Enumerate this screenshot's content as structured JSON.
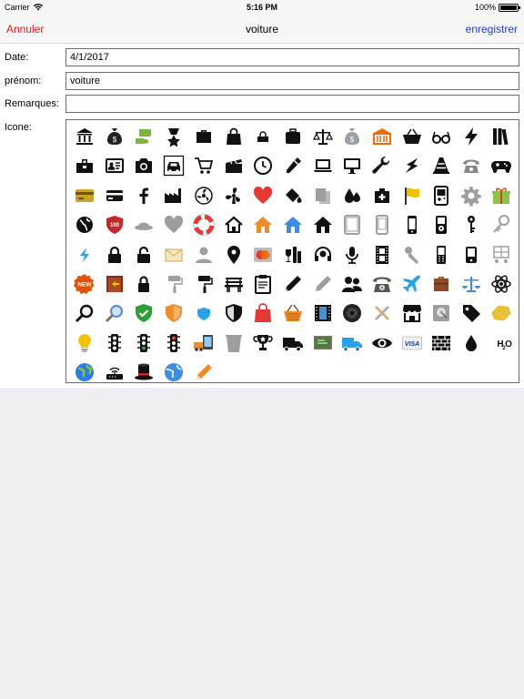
{
  "status_bar": {
    "carrier": "Carrier",
    "time": "5:16 PM",
    "battery": "100%",
    "battery_level": 1.0
  },
  "nav": {
    "cancel_label": "Annuler",
    "title": "voiture",
    "save_label": "enregistrer"
  },
  "form": {
    "date_label": "Date:",
    "date_value": "4/1/2017",
    "firstname_label": "prénom:",
    "firstname_value": "voiture",
    "remarks_label": "Remarques:",
    "remarks_value": "",
    "icon_label": "Icone:"
  },
  "colors": {
    "accent_red": "#e31b1b",
    "accent_blue": "#1d3fd6"
  },
  "icons": [
    {
      "name": "bank",
      "color": "#111111"
    },
    {
      "name": "money-bag",
      "color": "#222222"
    },
    {
      "name": "money-hand",
      "color": "#7cb342"
    },
    {
      "name": "medal",
      "color": "#111111"
    },
    {
      "name": "briefcase",
      "color": "#111111"
    },
    {
      "name": "shopping-bag",
      "color": "#111111"
    },
    {
      "name": "small-bag",
      "color": "#111111"
    },
    {
      "name": "suitcase",
      "color": "#111111"
    },
    {
      "name": "scales",
      "color": "#111111"
    },
    {
      "name": "money-sack",
      "color": "#9aa0a6"
    },
    {
      "name": "museum",
      "color": "#ef6c00"
    },
    {
      "name": "basket",
      "color": "#111111"
    },
    {
      "name": "glasses",
      "color": "#111111"
    },
    {
      "name": "lightning",
      "color": "#111111"
    },
    {
      "name": "books",
      "color": "#111111"
    },
    {
      "name": "toolbox",
      "color": "#111111"
    },
    {
      "name": "id-card",
      "color": "#111111"
    },
    {
      "name": "camera",
      "color": "#111111"
    },
    {
      "name": "car",
      "color": "#111111"
    },
    {
      "name": "cart",
      "color": "#111111"
    },
    {
      "name": "clapperboard",
      "color": "#111111"
    },
    {
      "name": "clock",
      "color": "#111111"
    },
    {
      "name": "pipette",
      "color": "#111111"
    },
    {
      "name": "laptop",
      "color": "#111111"
    },
    {
      "name": "computer",
      "color": "#111111"
    },
    {
      "name": "wrench",
      "color": "#111111"
    },
    {
      "name": "bolt",
      "color": "#111111"
    },
    {
      "name": "cone",
      "color": "#111111"
    },
    {
      "name": "telephone",
      "color": "#888888"
    },
    {
      "name": "gamepad",
      "color": "#111111"
    },
    {
      "name": "credit-card-gold",
      "color": "#c9a227"
    },
    {
      "name": "credit-card",
      "color": "#111111"
    },
    {
      "name": "facebook",
      "color": "#111111"
    },
    {
      "name": "factory",
      "color": "#111111"
    },
    {
      "name": "fan",
      "color": "#111111"
    },
    {
      "name": "fan-blades",
      "color": "#111111"
    },
    {
      "name": "heart",
      "color": "#e53935"
    },
    {
      "name": "paint-bucket",
      "color": "#111111"
    },
    {
      "name": "film-slides",
      "color": "#9e9e9e"
    },
    {
      "name": "drops",
      "color": "#111111"
    },
    {
      "name": "first-aid",
      "color": "#111111"
    },
    {
      "name": "flag",
      "color": "#f2c200"
    },
    {
      "name": "gameboy",
      "color": "#111111"
    },
    {
      "name": "gear",
      "color": "#9e9e9e"
    },
    {
      "name": "gift",
      "color": "#8bc34a"
    },
    {
      "name": "globe",
      "color": "#111111"
    },
    {
      "name": "shield-100",
      "color": "#c62828"
    },
    {
      "name": "hat",
      "color": "#9e9e9e"
    },
    {
      "name": "heart-gray",
      "color": "#9e9e9e"
    },
    {
      "name": "lifebuoy",
      "color": "#e53935"
    },
    {
      "name": "house-outline",
      "color": "#111111"
    },
    {
      "name": "house-orange",
      "color": "#ef8c2a"
    },
    {
      "name": "house-blue",
      "color": "#3f8ce0"
    },
    {
      "name": "house-black",
      "color": "#111111"
    },
    {
      "name": "tablet",
      "color": "#9e9e9e"
    },
    {
      "name": "phone-outline",
      "color": "#9e9e9e"
    },
    {
      "name": "phone",
      "color": "#111111"
    },
    {
      "name": "ipod",
      "color": "#111111"
    },
    {
      "name": "key",
      "color": "#111111"
    },
    {
      "name": "key-gray",
      "color": "#9e9e9e"
    },
    {
      "name": "lightning-blue",
      "color": "#29a3e8"
    },
    {
      "name": "lock",
      "color": "#111111"
    },
    {
      "name": "unlock",
      "color": "#111111"
    },
    {
      "name": "envelope",
      "color": "#d9b36a"
    },
    {
      "name": "person",
      "color": "#9e9e9e"
    },
    {
      "name": "map-pin",
      "color": "#111111"
    },
    {
      "name": "mastercard",
      "color": "#ef6c00"
    },
    {
      "name": "wine",
      "color": "#111111"
    },
    {
      "name": "headset",
      "color": "#111111"
    },
    {
      "name": "microphone",
      "color": "#111111"
    },
    {
      "name": "film",
      "color": "#111111"
    },
    {
      "name": "mic-gray",
      "color": "#9e9e9e"
    },
    {
      "name": "mobile",
      "color": "#111111"
    },
    {
      "name": "mobile-alt",
      "color": "#111111"
    },
    {
      "name": "cart-gray",
      "color": "#9e9e9e"
    },
    {
      "name": "new-badge",
      "color": "#e65100"
    },
    {
      "name": "door",
      "color": "#8d2a0e"
    },
    {
      "name": "padlock",
      "color": "#111111"
    },
    {
      "name": "paint-roller-gray",
      "color": "#9e9e9e"
    },
    {
      "name": "paint-roller",
      "color": "#111111"
    },
    {
      "name": "bench",
      "color": "#111111"
    },
    {
      "name": "clipboard",
      "color": "#111111"
    },
    {
      "name": "pen",
      "color": "#111111"
    },
    {
      "name": "pencil-gray",
      "color": "#9e9e9e"
    },
    {
      "name": "people",
      "color": "#111111"
    },
    {
      "name": "rotary-phone",
      "color": "#555555"
    },
    {
      "name": "plane",
      "color": "#29a3e8"
    },
    {
      "name": "briefcase-brown",
      "color": "#8d4a24"
    },
    {
      "name": "scales-blue",
      "color": "#3f8ce0"
    },
    {
      "name": "atom",
      "color": "#111111"
    },
    {
      "name": "magnifier",
      "color": "#111111"
    },
    {
      "name": "magnifier-blue",
      "color": "#5c8fd6"
    },
    {
      "name": "shield-check",
      "color": "#2e9e3a"
    },
    {
      "name": "shield-orange",
      "color": "#ef8c2a"
    },
    {
      "name": "shield-blue",
      "color": "#29a3e8"
    },
    {
      "name": "shield-black",
      "color": "#111111"
    },
    {
      "name": "bag-red",
      "color": "#e53935"
    },
    {
      "name": "basket-orange",
      "color": "#ef8c2a"
    },
    {
      "name": "film-strip",
      "color": "#111111"
    },
    {
      "name": "speaker",
      "color": "#222222"
    },
    {
      "name": "tools-cross",
      "color": "#d9b36a"
    },
    {
      "name": "store",
      "color": "#111111"
    },
    {
      "name": "hard-drive",
      "color": "#9e9e9e"
    },
    {
      "name": "tag",
      "color": "#111111"
    },
    {
      "name": "tag-gold",
      "color": "#e9c03a"
    },
    {
      "name": "bulb",
      "color": "#f2c200"
    },
    {
      "name": "traffic-light",
      "color": "#111111"
    },
    {
      "name": "traffic-light-green",
      "color": "#2e9e3a"
    },
    {
      "name": "traffic-light-red",
      "color": "#e53935"
    },
    {
      "name": "truck-tablet",
      "color": "#ef8c2a"
    },
    {
      "name": "trash",
      "color": "#9e9e9e"
    },
    {
      "name": "trophy",
      "color": "#111111"
    },
    {
      "name": "truck",
      "color": "#111111"
    },
    {
      "name": "chalkboard",
      "color": "#4a7d3a"
    },
    {
      "name": "truck-blue",
      "color": "#29a3e8"
    },
    {
      "name": "eye",
      "color": "#111111"
    },
    {
      "name": "visa",
      "color": "#1a3d8f"
    },
    {
      "name": "brick-wall",
      "color": "#111111"
    },
    {
      "name": "water-drop",
      "color": "#111111"
    },
    {
      "name": "h2o",
      "color": "#111111"
    },
    {
      "name": "globe-blue",
      "color": "#2b7de0"
    },
    {
      "name": "router",
      "color": "#111111"
    },
    {
      "name": "magic-hat",
      "color": "#111111"
    },
    {
      "name": "globe-blue-2",
      "color": "#3f8ce0"
    },
    {
      "name": "pencil",
      "color": "#ef8c2a"
    }
  ]
}
